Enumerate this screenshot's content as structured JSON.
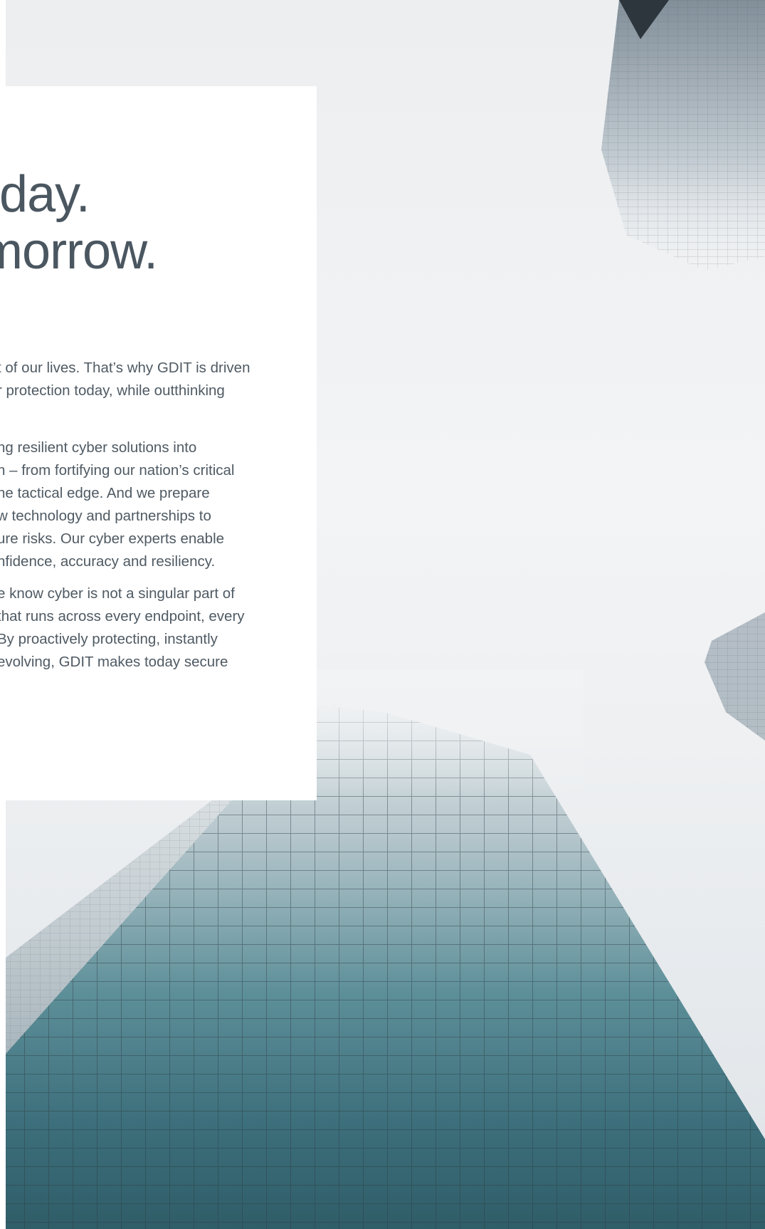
{
  "hero": {
    "image_alt": "Upward view of glass skyscrapers disappearing into fog"
  },
  "headline": {
    "line1": "oday.",
    "line2": "tomorrow."
  },
  "paragraphs": [
    {
      "lines": [
        "t of our lives. That’s why GDIT is driven",
        "r protection today, while outthinking"
      ]
    },
    {
      "lines": [
        "ng resilient cyber solutions into",
        "n – from fortifying our nation’s critical",
        "he tactical edge. And we prepare",
        "w technology and partnerships to",
        "ure risks. Our cyber experts enable",
        "nfidence, accuracy and resiliency."
      ]
    },
    {
      "lines": [
        "e know cyber is not a singular part of",
        "that runs across every endpoint, every",
        "By proactively protecting, instantly",
        "evolving, GDIT makes today secure"
      ]
    }
  ],
  "colors": {
    "headline": "#4a5660",
    "body_text": "#4f5a63",
    "panel": "#ffffff",
    "glass_teal": "#3f7d88",
    "frame_dark": "#2c3a41"
  }
}
